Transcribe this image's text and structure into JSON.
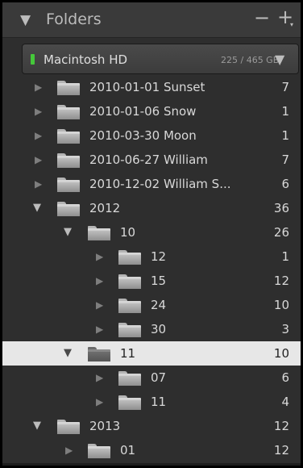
{
  "header": {
    "collapse_glyph": "▼",
    "title": "Folders",
    "remove_glyph": "−",
    "add_glyph": "+",
    "add_menu_glyph": "▾"
  },
  "volume": {
    "name": "Macintosh HD",
    "usage": "225 / 465 GB",
    "menu_glyph": "▼",
    "status_color": "#45c83a"
  },
  "tree": [
    {
      "label": "2010-01-01 Sunset",
      "count": "7",
      "depth": 0,
      "expanded": false,
      "selected": false
    },
    {
      "label": "2010-01-06 Snow",
      "count": "1",
      "depth": 0,
      "expanded": false,
      "selected": false
    },
    {
      "label": "2010-03-30 Moon",
      "count": "1",
      "depth": 0,
      "expanded": false,
      "selected": false
    },
    {
      "label": "2010-06-27 William",
      "count": "7",
      "depth": 0,
      "expanded": false,
      "selected": false
    },
    {
      "label": "2010-12-02 William S...",
      "count": "6",
      "depth": 0,
      "expanded": false,
      "selected": false
    },
    {
      "label": "2012",
      "count": "36",
      "depth": 0,
      "expanded": true,
      "selected": false
    },
    {
      "label": "10",
      "count": "26",
      "depth": 1,
      "expanded": true,
      "selected": false
    },
    {
      "label": "12",
      "count": "1",
      "depth": 2,
      "expanded": false,
      "selected": false
    },
    {
      "label": "15",
      "count": "12",
      "depth": 2,
      "expanded": false,
      "selected": false
    },
    {
      "label": "24",
      "count": "10",
      "depth": 2,
      "expanded": false,
      "selected": false
    },
    {
      "label": "30",
      "count": "3",
      "depth": 2,
      "expanded": false,
      "selected": false
    },
    {
      "label": "11",
      "count": "10",
      "depth": 1,
      "expanded": true,
      "selected": true
    },
    {
      "label": "07",
      "count": "6",
      "depth": 2,
      "expanded": false,
      "selected": false
    },
    {
      "label": "11",
      "count": "4",
      "depth": 2,
      "expanded": false,
      "selected": false
    },
    {
      "label": "2013",
      "count": "12",
      "depth": 0,
      "expanded": true,
      "selected": false
    },
    {
      "label": "01",
      "count": "12",
      "depth": 1,
      "expanded": false,
      "selected": false
    }
  ],
  "glyphs": {
    "collapsed": "▶",
    "expanded": "▼"
  },
  "colors": {
    "panel_bg": "#2e2e2e",
    "selection_bg": "#e7e7e7",
    "text": "#d8d8d8"
  }
}
